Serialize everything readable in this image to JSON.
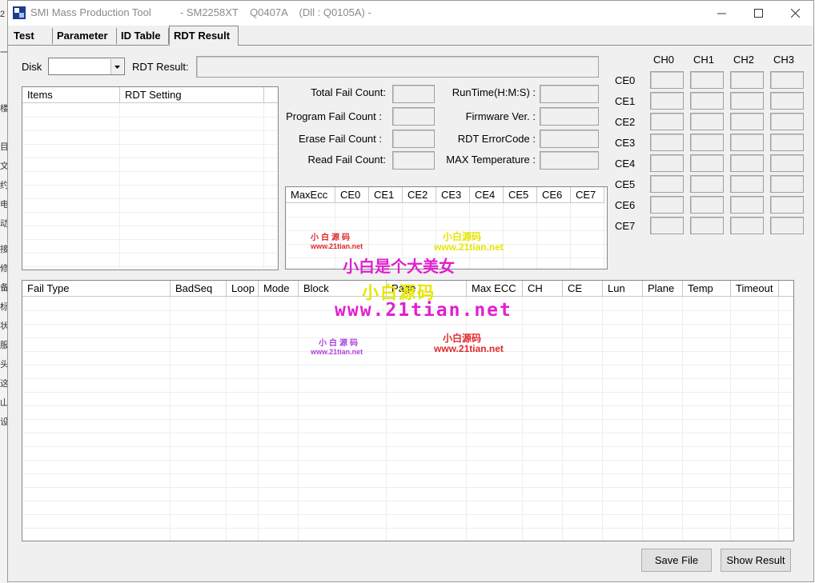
{
  "background": {
    "side_chars": [
      "2",
      "一",
      "楼",
      "目",
      "文",
      "约",
      "电",
      "动",
      "接",
      "修",
      "备",
      "标",
      "状",
      "服",
      "头",
      "这",
      "山",
      "设"
    ]
  },
  "window": {
    "title": "SMI Mass Production Tool          - SM2258XT    Q0407A    (Dll : Q0105A) -",
    "icon": "smi-app-icon"
  },
  "tabs": [
    "Test",
    "Parameter",
    "ID Table",
    "RDT Result"
  ],
  "active_tab": "RDT Result",
  "disk": {
    "label": "Disk",
    "value": ""
  },
  "rdt_result": {
    "label": "RDT Result:",
    "value": ""
  },
  "settings_table": {
    "headers": [
      "Items",
      "RDT Setting"
    ]
  },
  "counts": {
    "total_fail": {
      "label": "Total Fail Count:",
      "value": ""
    },
    "program_fail": {
      "label": "Program Fail Count :",
      "value": ""
    },
    "erase_fail": {
      "label": "Erase Fail Count :",
      "value": ""
    },
    "read_fail": {
      "label": "Read Fail Count:",
      "value": ""
    },
    "runtime": {
      "label": "RunTime(H:M:S) :",
      "value": ""
    },
    "firmware": {
      "label": "Firmware Ver. :",
      "value": ""
    },
    "rdt_error_code": {
      "label": "RDT ErrorCode :",
      "value": ""
    },
    "max_temperature": {
      "label": "MAX Temperature :",
      "value": ""
    }
  },
  "ecc_table": {
    "headers": [
      "MaxEcc",
      "CE0",
      "CE1",
      "CE2",
      "CE3",
      "CE4",
      "CE5",
      "CE6",
      "CE7"
    ]
  },
  "ch_grid": {
    "channels": [
      "CH0",
      "CH1",
      "CH2",
      "CH3"
    ],
    "ces": [
      "CE0",
      "CE1",
      "CE2",
      "CE3",
      "CE4",
      "CE5",
      "CE6",
      "CE7"
    ]
  },
  "fail_table": {
    "headers": [
      "Fail Type",
      "BadSeq",
      "Loop",
      "Mode",
      "Block",
      "Page",
      "Max ECC",
      "CH",
      "CE",
      "Lun",
      "Plane",
      "Temp",
      "Timeout"
    ]
  },
  "buttons": {
    "save_file": "Save File",
    "show_result": "Show Result"
  },
  "watermarks": {
    "brand_small": "小白源码",
    "url_small": "www.21tian.net",
    "slogan": "小白是个大美女",
    "brand_large": "小白源码",
    "url_large": "www.21tian.net",
    "color_red": "#e0282c",
    "color_magenta": "#e020d0",
    "color_yellow": "#e6e600",
    "color_purple": "#b040e0"
  }
}
